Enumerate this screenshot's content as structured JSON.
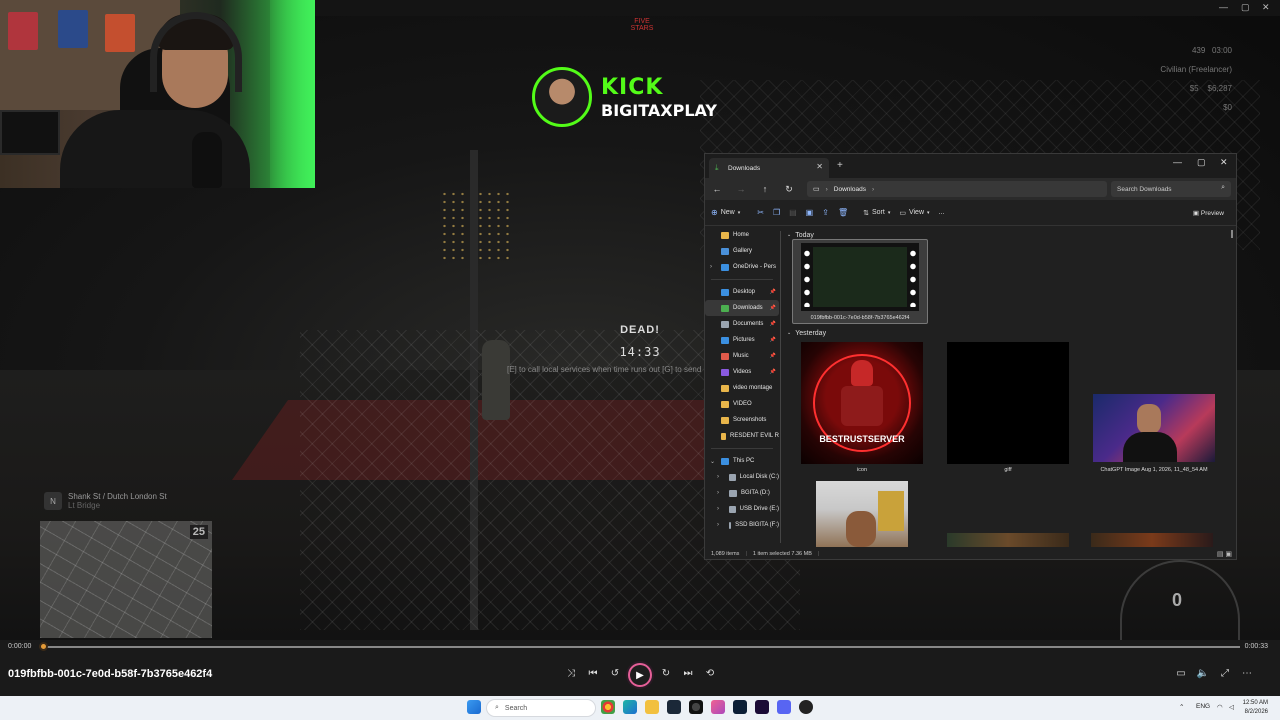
{
  "video": {
    "stream": {
      "brand": "KICK",
      "username": "BIGITAXPLAY",
      "server_logo": "FIVE STARS"
    },
    "hud": {
      "top_right_numbers": "439",
      "top_right_time": "03:00",
      "job": "Civilian (Freelancer)",
      "cash": "$5",
      "bank": "$6,287",
      "dirty": "$0"
    },
    "death_screen": {
      "title": "DEAD!",
      "timer": "14:33",
      "hint": "[E] to call local services when time runs out  [G] to send"
    },
    "location": {
      "badge": "N",
      "street": "Shank St / Dutch London St",
      "zone": "Lt Bridge"
    },
    "minimap_speed": "25",
    "speedometer": "0"
  },
  "explorer": {
    "tab_title": "Downloads",
    "address": [
      "Downloads"
    ],
    "search_placeholder": "Search Downloads",
    "commands": {
      "new": "New",
      "sort": "Sort",
      "view": "View",
      "more": "...",
      "preview": "Preview"
    },
    "nav_pane": [
      {
        "label": "Home",
        "icon": "home-icon",
        "color": "#e8b54a"
      },
      {
        "label": "Gallery",
        "icon": "gallery-icon",
        "color": "#4a90d9"
      },
      {
        "label": "OneDrive - Pers",
        "icon": "cloud-icon",
        "color": "#3b8fe0",
        "chevron": true
      },
      {
        "label": "Desktop",
        "icon": "desktop-icon",
        "color": "#3b8fe0",
        "pinned": true
      },
      {
        "label": "Downloads",
        "icon": "download-icon",
        "color": "#4caf50",
        "pinned": true,
        "selected": true
      },
      {
        "label": "Documents",
        "icon": "documents-icon",
        "color": "#9aa4b0",
        "pinned": true
      },
      {
        "label": "Pictures",
        "icon": "pictures-icon",
        "color": "#3b8fe0",
        "pinned": true
      },
      {
        "label": "Music",
        "icon": "music-icon",
        "color": "#e05a4a",
        "pinned": true
      },
      {
        "label": "Videos",
        "icon": "videos-icon",
        "color": "#8a5ae0",
        "pinned": true
      },
      {
        "label": "video montage",
        "icon": "folder-icon",
        "color": "#e8b54a"
      },
      {
        "label": "VIDEO",
        "icon": "folder-icon",
        "color": "#e8b54a"
      },
      {
        "label": "Screenshots",
        "icon": "folder-icon",
        "color": "#e8b54a"
      },
      {
        "label": "RESDENT EVIL R",
        "icon": "folder-icon",
        "color": "#e8b54a"
      },
      {
        "label": "This PC",
        "icon": "pc-icon",
        "color": "#3b8fe0",
        "chevron": true,
        "expanded": true
      },
      {
        "label": "Local Disk (C:)",
        "icon": "drive-icon",
        "color": "#9aa4b0",
        "chevron": true,
        "indent": true
      },
      {
        "label": "BGITA (D:)",
        "icon": "drive-icon",
        "color": "#9aa4b0",
        "chevron": true,
        "indent": true
      },
      {
        "label": "USB Drive (E:)",
        "icon": "drive-icon",
        "color": "#9aa4b0",
        "chevron": true,
        "indent": true
      },
      {
        "label": "SSD BIGITA (F:)",
        "icon": "drive-icon",
        "color": "#9aa4b0",
        "chevron": true,
        "indent": true
      }
    ],
    "groups": {
      "today": "Today",
      "yesterday": "Yesterday"
    },
    "files": {
      "today_1": "019fbfbb-001c-7e0d-b58f-7b3765e462f4",
      "yest_1": "icon",
      "yest_2": "giff",
      "yest_3": "ChatGPT Image Aug 1, 2026, 11_48_54 AM",
      "icon_text": "BESTRUSTSERVER"
    },
    "status": {
      "count": "1,089 items",
      "selected": "1 item selected  7.36 MB"
    }
  },
  "player": {
    "time_elapsed": "0:00:00",
    "time_total": "0:00:33",
    "progress": 0.0,
    "file_title": "019fbfbb-001c-7e0d-b58f-7b3765e462f4"
  },
  "taskbar": {
    "search_placeholder": "Search",
    "lang": "ENG",
    "time": "12:50 AM",
    "date": "8/2/2026"
  },
  "colors": {
    "kick_green": "#53fc18",
    "play_button": "#e45f97",
    "seek_thumb": "#e59b37"
  }
}
